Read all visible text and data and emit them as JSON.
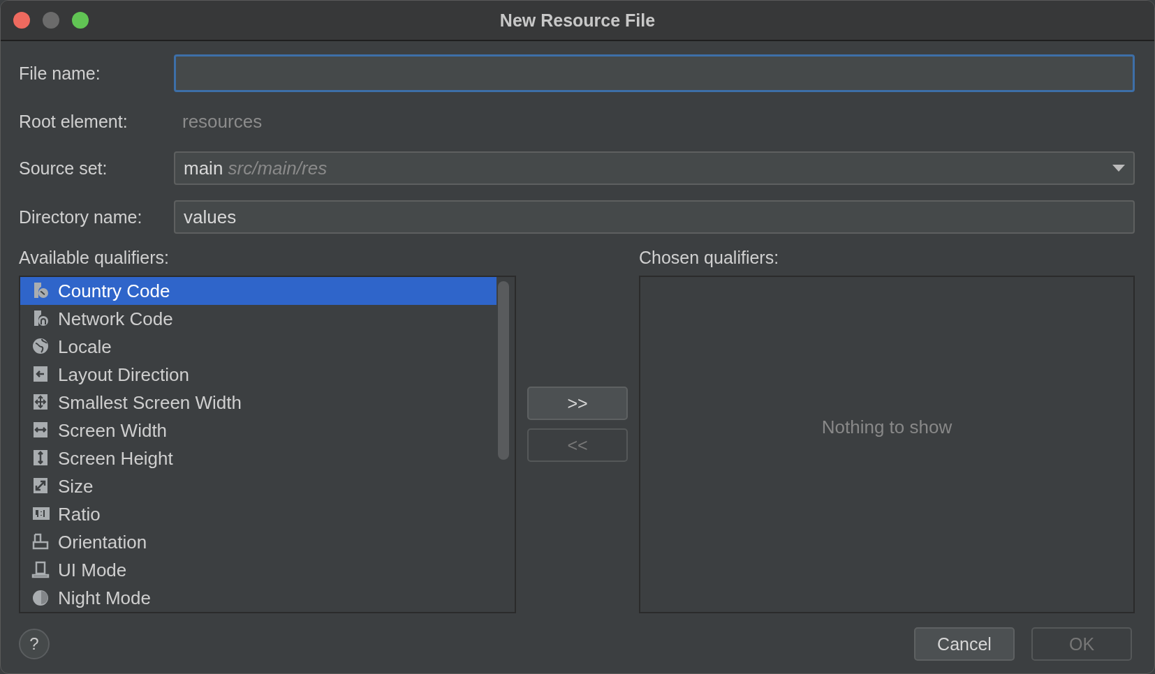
{
  "window": {
    "title": "New Resource File"
  },
  "form": {
    "file_name": {
      "label": "File name:",
      "focused": true
    },
    "root_element": {
      "label": "Root element:",
      "value": "resources"
    },
    "source_set": {
      "label": "Source set:",
      "value": "main *src/main/res*"
    },
    "directory_name": {
      "label": "Directory name:",
      "value": "values"
    }
  },
  "available_qualifiers": {
    "label": "Available qualifiers:",
    "items": [
      {
        "label": "Country Code",
        "selected": true
      },
      {
        "label": "Network Code",
        "selected": false
      },
      {
        "label": "Locale",
        "selected": false
      },
      {
        "label": "Layout Direction",
        "selected": false
      },
      {
        "label": "Smallest Screen Width",
        "selected": false
      },
      {
        "label": "Screen Width",
        "selected": false
      },
      {
        "label": "Screen Height",
        "selected": false
      },
      {
        "label": "Size",
        "selected": false
      },
      {
        "label": "Ratio",
        "selected": false
      },
      {
        "label": "Orientation",
        "selected": false
      },
      {
        "label": "UI Mode",
        "selected": false
      },
      {
        "label": "Night Mode",
        "selected": false
      }
    ]
  },
  "transfer_buttons": [
    {
      "label": ">>",
      "disabled": false
    },
    {
      "label": "<<",
      "disabled": true
    }
  ],
  "chosen_qualifiers": {
    "label": "Chosen qualifiers:",
    "empty_text": "Nothing to show"
  },
  "buttons": [
    {
      "label": "Cancel",
      "disabled": false
    },
    {
      "label": "OK",
      "disabled": true
    }
  ],
  "help": {
    "label": "?"
  }
}
